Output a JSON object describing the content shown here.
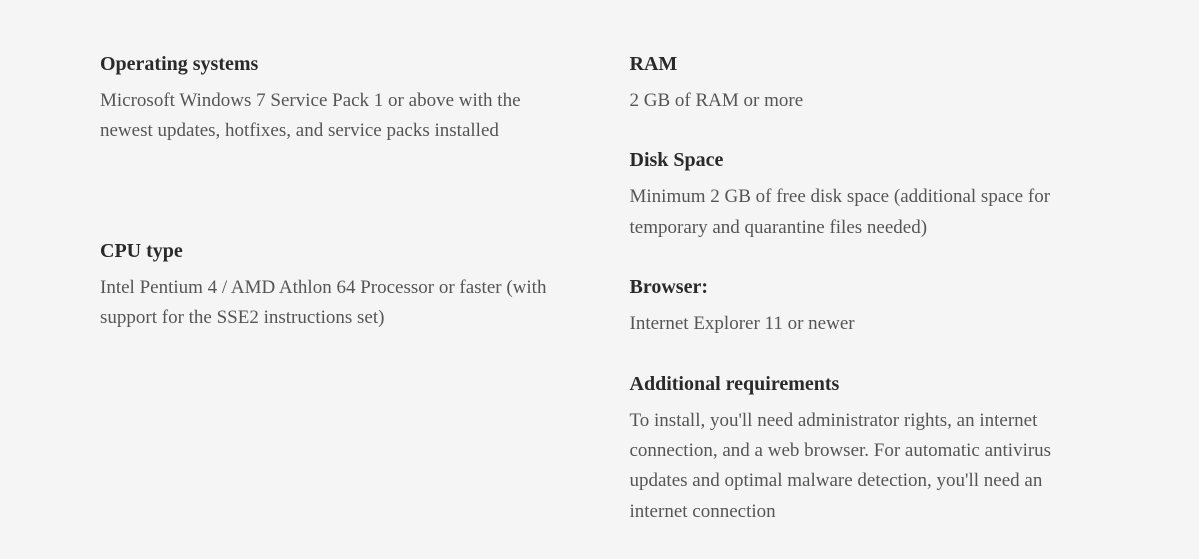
{
  "left": {
    "os": {
      "heading": "Operating systems",
      "body": "Microsoft Windows 7 Service Pack 1 or above with the newest updates, hotfixes, and service packs installed"
    },
    "cpu": {
      "heading": "CPU type",
      "body": "Intel Pentium 4 / AMD Athlon 64 Processor or faster (with support for the SSE2 instructions set)"
    }
  },
  "right": {
    "ram": {
      "heading": "RAM",
      "body": "2 GB of RAM or more"
    },
    "disk": {
      "heading": "Disk Space",
      "body": "Minimum 2 GB of free disk space (additional space for temporary and quarantine files needed)"
    },
    "browser": {
      "heading": "Browser:",
      "body": "Internet Explorer 11 or newer"
    },
    "additional": {
      "heading": "Additional requirements",
      "body": "To install, you'll need administrator rights, an internet connection, and a web browser. For automatic antivirus updates and optimal malware detection, you'll need an internet connection"
    }
  }
}
